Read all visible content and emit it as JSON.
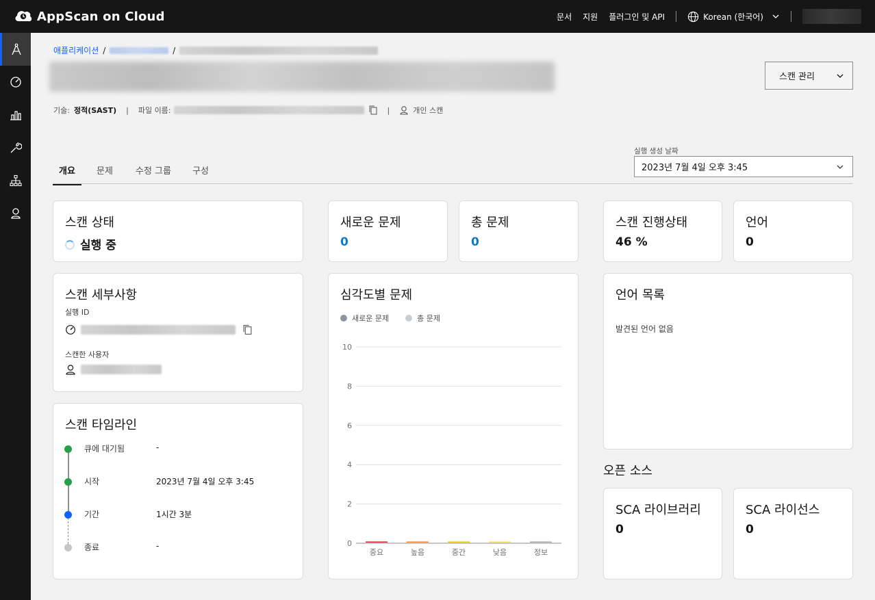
{
  "app": {
    "name": "AppScan on Cloud"
  },
  "topnav": {
    "docs": "문서",
    "support": "지원",
    "plugins": "플러그인 및 API",
    "language": "Korean (한국어)"
  },
  "breadcrumb": {
    "root": "애플리케이션",
    "separator": "/"
  },
  "meta": {
    "tech_label": "기술:",
    "tech_value": "정적(SAST)",
    "file_label": "파일 이름:",
    "scan_type": "개인 스캔"
  },
  "actions": {
    "manage_scan": "스캔 관리"
  },
  "tabs": [
    {
      "label": "개요",
      "active": true
    },
    {
      "label": "문제",
      "active": false
    },
    {
      "label": "수정 그룹",
      "active": false
    },
    {
      "label": "구성",
      "active": false
    }
  ],
  "execution_date": {
    "label": "실행 생성 날짜",
    "value": "2023년 7월 4일 오후 3:45"
  },
  "cards": {
    "scan_status": {
      "title": "스캔 상태",
      "value": "실행 중"
    },
    "new_issues": {
      "title": "새로운 문제",
      "value": "0"
    },
    "total_issues": {
      "title": "총 문제",
      "value": "0"
    },
    "scan_progress": {
      "title": "스캔 진행상태",
      "value": "46 %",
      "percent": 46
    },
    "languages": {
      "title": "언어",
      "value": "0"
    },
    "scan_details": {
      "title": "스캔 세부사항",
      "execution_id_label": "실행 ID",
      "scanned_by_label": "스캔한 사용자"
    },
    "severity": {
      "title": "심각도별 문제"
    },
    "language_list": {
      "title": "언어 목록",
      "empty": "발견된 언어 없음"
    },
    "timeline": {
      "title": "스캔 타임라인",
      "rows": [
        {
          "label": "큐에 대기됨",
          "value": "-",
          "status": "done"
        },
        {
          "label": "시작",
          "value": "2023년 7월 4일 오후 3:45",
          "status": "done"
        },
        {
          "label": "기간",
          "value": "1시간 3분",
          "status": "current"
        },
        {
          "label": "종료",
          "value": "-",
          "status": "pending"
        }
      ]
    },
    "open_source": {
      "section_title": "오픈 소스",
      "sca_libraries": {
        "title": "SCA 라이브러리",
        "value": "0"
      },
      "sca_licenses": {
        "title": "SCA 라이선스",
        "value": "0"
      }
    }
  },
  "colors": {
    "accent": "#0f62fe",
    "value_blue": "#0f7bc2",
    "timeline_done": "#24a148",
    "timeline_current": "#0f62fe",
    "timeline_pending": "#c6c6c6"
  },
  "chart_data": {
    "type": "bar",
    "title": "심각도별 문제",
    "categories": [
      "중요",
      "높음",
      "중간",
      "낮음",
      "정보"
    ],
    "series": [
      {
        "name": "새로운 문제",
        "values": [
          0,
          0,
          0,
          0,
          0
        ],
        "color": "#8d96a0"
      },
      {
        "name": "총 문제",
        "values": [
          0,
          0,
          0,
          0,
          0
        ],
        "color": "#c9ced4"
      }
    ],
    "bar_colors": [
      "#da1e28",
      "#ff832b",
      "#f1c21b",
      "#fddc69",
      "#a8a8a8"
    ],
    "ylim": [
      0,
      10
    ],
    "yticks": [
      0,
      2,
      4,
      6,
      8,
      10
    ],
    "grid": true,
    "legend": "top-left"
  }
}
